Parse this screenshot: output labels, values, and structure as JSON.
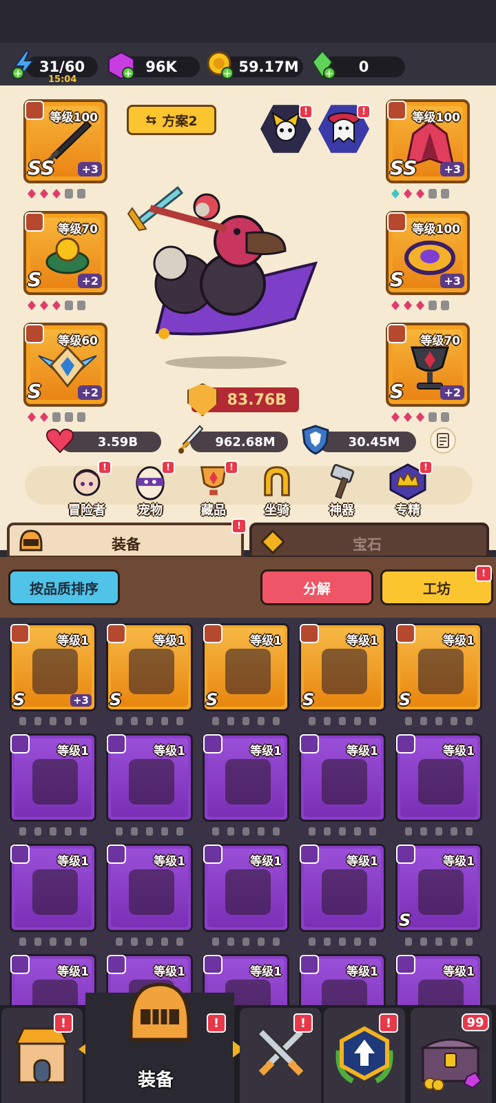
{
  "resources": {
    "energy": "31/60",
    "energy_timer": "15:04",
    "gems": "96K",
    "gold": "59.17M",
    "emerald": "0"
  },
  "equipped_left": [
    {
      "level": "等级100",
      "grade": "SS",
      "plus": "+3",
      "icon": "dark-sword-icon"
    },
    {
      "level": "等级70",
      "grade": "S",
      "plus": "+2",
      "icon": "ring-icon"
    },
    {
      "level": "等级60",
      "grade": "S",
      "plus": "+2",
      "icon": "winged-amulet-icon"
    }
  ],
  "equipped_right": [
    {
      "level": "等级100",
      "grade": "SS",
      "plus": "+3",
      "icon": "robe-icon"
    },
    {
      "level": "等级100",
      "grade": "S",
      "plus": "+3",
      "icon": "ring-icon"
    },
    {
      "level": "等级70",
      "grade": "S",
      "plus": "+2",
      "icon": "chalice-icon"
    }
  ],
  "plan_button": "方案2",
  "combat_power": "83.76B",
  "stats": {
    "hp": "3.59B",
    "attack": "962.68M",
    "defense": "30.45M"
  },
  "menu": [
    {
      "label": "冒险者",
      "icon": "adventurer-icon",
      "badge": "!"
    },
    {
      "label": "宠物",
      "icon": "egg-icon",
      "badge": "!"
    },
    {
      "label": "藏品",
      "icon": "trophy-icon",
      "badge": "!"
    },
    {
      "label": "坐骑",
      "icon": "horseshoe-icon",
      "badge": ""
    },
    {
      "label": "神器",
      "icon": "hammer-icon",
      "badge": ""
    },
    {
      "label": "专精",
      "icon": "crown-icon",
      "badge": "!"
    }
  ],
  "tabs": {
    "equipment": "装备",
    "gems": "宝石"
  },
  "buttons": {
    "sort": "按品质排序",
    "dismantle": "分解",
    "workshop": "工坊"
  },
  "inventory": [
    {
      "level": "等级1",
      "rarity": "gold",
      "grade": "S",
      "plus": "+3",
      "icon": "dark-sword-icon"
    },
    {
      "level": "等级1",
      "rarity": "gold",
      "grade": "S",
      "plus": "",
      "icon": "bow-icon"
    },
    {
      "level": "等级1",
      "rarity": "gold",
      "grade": "S",
      "plus": "",
      "icon": "armor-icon"
    },
    {
      "level": "等级1",
      "rarity": "gold",
      "grade": "S",
      "plus": "",
      "icon": "armor-icon"
    },
    {
      "level": "等级1",
      "rarity": "gold",
      "grade": "S",
      "plus": "",
      "icon": "sun-amulet-icon"
    },
    {
      "level": "等级1",
      "rarity": "purple",
      "grade": "",
      "plus": "",
      "icon": "wooden-sword-icon"
    },
    {
      "level": "等级1",
      "rarity": "purple",
      "grade": "",
      "plus": "",
      "icon": "steel-sword-icon"
    },
    {
      "level": "等级1",
      "rarity": "purple",
      "grade": "",
      "plus": "",
      "icon": "bow-icon"
    },
    {
      "level": "等级1",
      "rarity": "purple",
      "grade": "",
      "plus": "",
      "icon": "staff-icon"
    },
    {
      "level": "等级1",
      "rarity": "purple",
      "grade": "",
      "plus": "",
      "icon": "wand-icon"
    },
    {
      "level": "等级1",
      "rarity": "purple",
      "grade": "",
      "plus": "",
      "icon": "wand-icon"
    },
    {
      "level": "等级1",
      "rarity": "purple",
      "grade": "",
      "plus": "",
      "icon": "wand-icon"
    },
    {
      "level": "等级1",
      "rarity": "purple",
      "grade": "",
      "plus": "",
      "icon": "wand-icon"
    },
    {
      "level": "等级1",
      "rarity": "purple",
      "grade": "",
      "plus": "",
      "icon": "wand-icon"
    },
    {
      "level": "等级1",
      "rarity": "purple",
      "grade": "S",
      "plus": "",
      "icon": "mace-icon"
    },
    {
      "level": "等级1",
      "rarity": "purple",
      "grade": "",
      "plus": "",
      "icon": "star-wand-icon"
    },
    {
      "level": "等级1",
      "rarity": "purple",
      "grade": "",
      "plus": "",
      "icon": "armor-icon"
    },
    {
      "level": "等级1",
      "rarity": "purple",
      "grade": "",
      "plus": "",
      "icon": "armor-icon"
    },
    {
      "level": "等级1",
      "rarity": "purple",
      "grade": "",
      "plus": "",
      "icon": "armor-icon"
    },
    {
      "level": "等级1",
      "rarity": "purple",
      "grade": "",
      "plus": "",
      "icon": "armor-icon"
    }
  ],
  "nav": {
    "active_label": "装备",
    "chest_count": "99",
    "badge": "!"
  },
  "colors": {
    "gold": "#f4a827",
    "purple": "#8b3ec9",
    "alert": "#e8384a",
    "accent_blue": "#4fc4e8"
  }
}
